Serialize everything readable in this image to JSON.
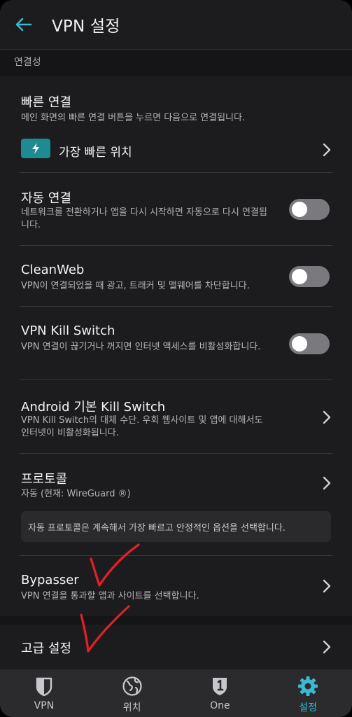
{
  "header": {
    "title": "VPN 설정"
  },
  "section": {
    "label": "연결성"
  },
  "rows": {
    "quick_connect": {
      "title": "빠른 연결",
      "desc": "메인 화면의 빠른 연결 버튼을 누르면 다음으로 연결됩니다.",
      "value": "가장 빠른 위치"
    },
    "auto_connect": {
      "title": "자동 연결",
      "desc": "네트워크를 전환하거나 앱을 다시 시작하면 자동으로 다시 연결됩니다.",
      "enabled": false
    },
    "cleanweb": {
      "title": "CleanWeb",
      "desc": "VPN이 연결되었을 때 광고, 트래커 및 맬웨어를 차단합니다.",
      "enabled": false
    },
    "kill_switch": {
      "title": "VPN Kill Switch",
      "desc": "VPN 연결이 끊기거나 꺼지면 인터넷 액세스를 비활성화합니다.",
      "enabled": false
    },
    "android_kill_switch": {
      "title": "Android 기본 Kill Switch",
      "desc": "VPN Kill Switch의 대체 수단. 우회 웹사이트 및 앱에 대해서도 인터넷이 비활성화됩니다."
    },
    "protocol": {
      "title": "프로토콜",
      "desc": "자동 (현재: WireGuard ®)",
      "info": "자동 프로토콜은 계속해서 가장 빠르고 안정적인 옵션을 선택합니다."
    },
    "bypasser": {
      "title": "Bypasser",
      "desc": "VPN 연결을 통과할 앱과 사이트를 선택합니다."
    },
    "advanced": {
      "title": "고급 설정"
    }
  },
  "nav": {
    "items": [
      {
        "label": "VPN",
        "icon": "shield-icon"
      },
      {
        "label": "위치",
        "icon": "globe-icon"
      },
      {
        "label": "One",
        "icon": "one-shield-icon"
      },
      {
        "label": "설정",
        "icon": "gear-icon",
        "active": true
      }
    ]
  },
  "colors": {
    "accent": "#3bb9d0",
    "badge": "#1d8b91",
    "annotation": "#e3202a"
  }
}
